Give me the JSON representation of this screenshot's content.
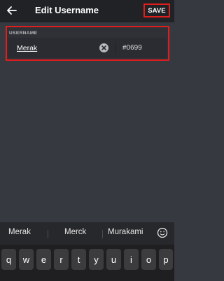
{
  "header": {
    "title": "Edit Username",
    "save_label": "SAVE"
  },
  "form": {
    "section_label": "USERNAME",
    "username_value": "Merak",
    "discriminator": "#0699"
  },
  "suggestions": {
    "items": [
      "Merak",
      "Merck",
      "Murakami"
    ]
  },
  "keyboard": {
    "row1": [
      "q",
      "w",
      "e",
      "r",
      "t",
      "y",
      "u",
      "i",
      "o",
      "p"
    ]
  },
  "colors": {
    "background": "#36393f",
    "header": "#202225",
    "highlight": "#e01e1e"
  }
}
